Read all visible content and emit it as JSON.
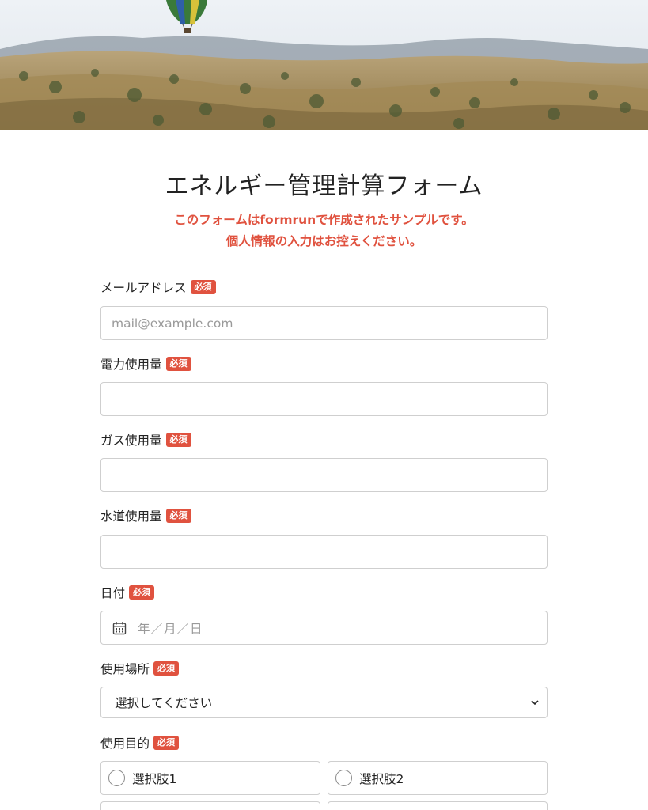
{
  "form": {
    "title": "エネルギー管理計算フォーム",
    "notice_line1": "このフォームはformrunで作成されたサンプルです。",
    "notice_line2": "個人情報の入力はお控えください。",
    "required_badge": "必須"
  },
  "fields": {
    "email": {
      "label": "メールアドレス",
      "placeholder": "mail@example.com",
      "value": ""
    },
    "electricity": {
      "label": "電力使用量",
      "value": ""
    },
    "gas": {
      "label": "ガス使用量",
      "value": ""
    },
    "water": {
      "label": "水道使用量",
      "value": ""
    },
    "date": {
      "label": "日付",
      "placeholder": "年／月／日"
    },
    "location": {
      "label": "使用場所",
      "selected": "選択してください"
    },
    "purpose": {
      "label": "使用目的",
      "options": [
        "選択肢1",
        "選択肢2"
      ]
    }
  },
  "colors": {
    "accent": "#e0523f",
    "border": "#cfcfcf",
    "text": "#222222",
    "placeholder": "#9a9a9a"
  },
  "icons": {
    "date": "calendar-icon",
    "select": "chevron-down-icon",
    "radio": "radio-circle"
  }
}
